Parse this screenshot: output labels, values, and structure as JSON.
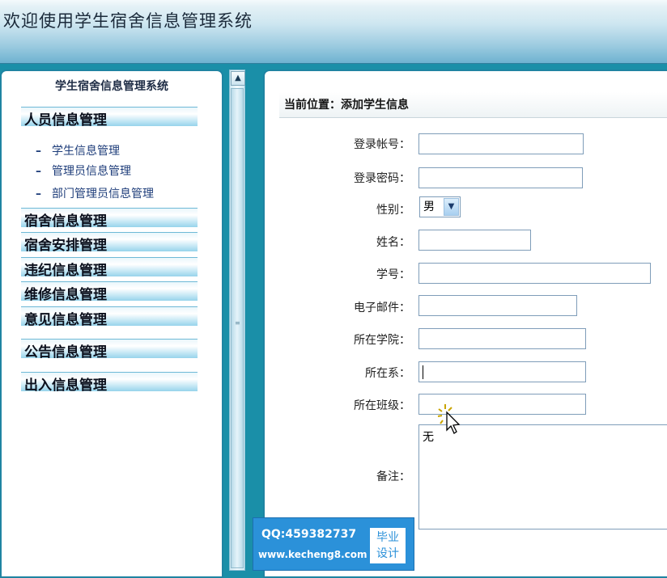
{
  "header": {
    "title": "欢迎使用学生宿舍信息管理系统"
  },
  "sidebar": {
    "title": "学生宿舍信息管理系统",
    "groups": [
      {
        "label": "人员信息管理",
        "items": [
          "学生信息管理",
          "管理员信息管理",
          "部门管理员信息管理"
        ]
      },
      {
        "label": "宿舍信息管理"
      },
      {
        "label": "宿舍安排管理"
      },
      {
        "label": "违纪信息管理"
      },
      {
        "label": "维修信息管理"
      },
      {
        "label": "意见信息管理"
      },
      {
        "label": "公告信息管理"
      },
      {
        "label": "出入信息管理"
      }
    ],
    "sub_dash": "–"
  },
  "scrollbar": {
    "up_arrow": "▲",
    "grip": "≡"
  },
  "main": {
    "location": "当前位置：添加学生信息",
    "form": {
      "login_account": {
        "label": "登录帐号：",
        "value": ""
      },
      "login_password": {
        "label": "登录密码：",
        "value": ""
      },
      "gender": {
        "label": "性别：",
        "value": "男",
        "arrow": "▼"
      },
      "name": {
        "label": "姓名：",
        "value": ""
      },
      "student_id": {
        "label": "学号：",
        "value": ""
      },
      "email": {
        "label": "电子邮件：",
        "value": ""
      },
      "college": {
        "label": "所在学院：",
        "value": ""
      },
      "department": {
        "label": "所在系：",
        "value": ""
      },
      "class": {
        "label": "所在班级：",
        "value": ""
      },
      "remarks": {
        "label": "备注：",
        "value": "无"
      }
    }
  },
  "watermark": {
    "qq": "QQ:459382737",
    "url": "www.kecheng8.com",
    "badge_line1": "毕业",
    "badge_line2": "设计"
  }
}
